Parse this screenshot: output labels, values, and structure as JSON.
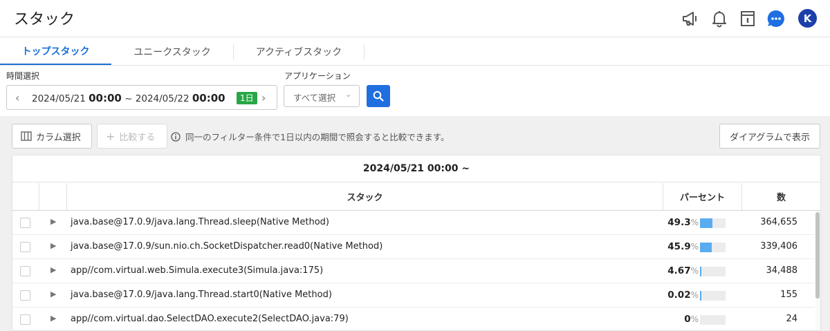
{
  "header": {
    "title": "スタック",
    "icons": [
      "megaphone-icon",
      "bell-icon",
      "document-icon",
      "chat-icon"
    ],
    "avatar_initial": "K",
    "accent_color": "#1a6fd8"
  },
  "tabs": [
    {
      "label": "トップスタック",
      "active": true
    },
    {
      "label": "ユニークスタック",
      "active": false
    },
    {
      "label": "アクティブスタック",
      "active": false
    }
  ],
  "filters": {
    "time_label": "時間選択",
    "start_date": "2024/05/21",
    "start_time": "00:00",
    "separator": "~",
    "end_date": "2024/05/22",
    "end_time": "00:00",
    "duration_badge": "1日",
    "app_label": "アプリケーション",
    "app_select_value": "すべて選択"
  },
  "toolbar": {
    "column_select": "カラム選択",
    "compare": "比較する",
    "hint": "同一のフィルター条件で1日以内の期間で照会すると比較できます。",
    "diagram": "ダイアグラムで表示"
  },
  "table": {
    "period_title": "2024/05/21 00:00 ~",
    "columns": {
      "stack": "スタック",
      "percent": "パーセント",
      "count": "数"
    },
    "percent_unit": "%",
    "rows": [
      {
        "stack": "java.base@17.0.9/java.lang.Thread.sleep(Native Method)",
        "percent": "49.3",
        "percent_value": 49.3,
        "count": "364,655"
      },
      {
        "stack": "java.base@17.0.9/sun.nio.ch.SocketDispatcher.read0(Native Method)",
        "percent": "45.9",
        "percent_value": 45.9,
        "count": "339,406"
      },
      {
        "stack": "app//com.virtual.web.Simula.execute3(Simula.java:175)",
        "percent": "4.67",
        "percent_value": 4.67,
        "count": "34,488"
      },
      {
        "stack": "java.base@17.0.9/java.lang.Thread.start0(Native Method)",
        "percent": "0.02",
        "percent_value": 0.02,
        "count": "155"
      },
      {
        "stack": "app//com.virtual.dao.SelectDAO.execute2(SelectDAO.java:79)",
        "percent": "0",
        "percent_value": 0,
        "count": "24"
      }
    ]
  }
}
